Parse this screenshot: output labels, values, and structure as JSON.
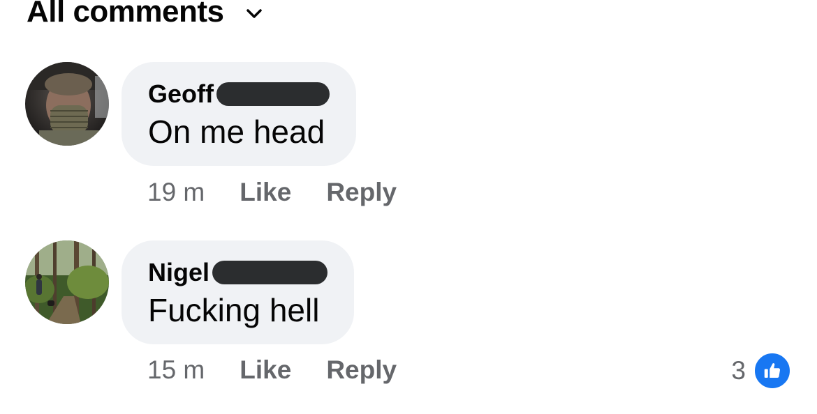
{
  "section": {
    "title": "All comments"
  },
  "comments": [
    {
      "author": "Geoff",
      "text": "On me head",
      "time": "19 m",
      "like_label": "Like",
      "reply_label": "Reply"
    },
    {
      "author": "Nigel",
      "text": "Fucking hell",
      "time": "15 m",
      "like_label": "Like",
      "reply_label": "Reply",
      "reaction_count": "3",
      "reaction_icon": "thumbs-up-icon"
    }
  ],
  "colors": {
    "bubble": "#f0f2f5",
    "meta_text": "#65676b",
    "like_blue": "#1877f2",
    "redaction": "#2b2d2f"
  }
}
